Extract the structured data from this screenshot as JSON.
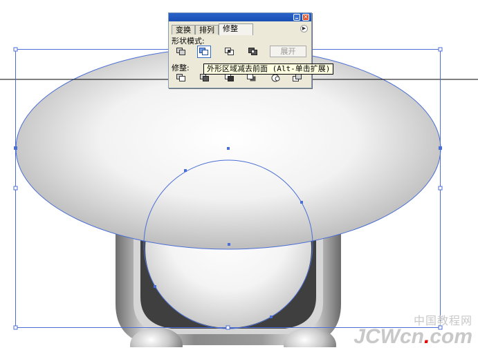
{
  "palette": {
    "tabs": [
      "变换",
      "排列",
      "修整"
    ],
    "active_tab": "修整",
    "shape_modes_label": "形状模式:",
    "expand_label": "展开",
    "pathfinders_label": "修整:",
    "shape_mode_tools": [
      "add-to-shape-area-icon",
      "subtract-from-shape-area-icon",
      "intersect-shape-areas-icon",
      "exclude-overlapping-shape-areas-icon"
    ],
    "pathfinder_tools": [
      "divide-icon",
      "trim-icon",
      "merge-icon",
      "crop-icon",
      "outline-icon",
      "minus-back-icon"
    ]
  },
  "tooltip": {
    "text": "外形区域减去前面 (Alt-单击扩展)"
  },
  "watermark": {
    "cn": "中国教程网",
    "en_main": "JCWcn",
    "en_dot": ".",
    "en_tld": "com"
  },
  "colors": {
    "selection": "#4a6ed6",
    "palette_bg": "#ece9d8",
    "titlebar": "#1f57c1",
    "tooltip_bg": "#ffffe1"
  }
}
